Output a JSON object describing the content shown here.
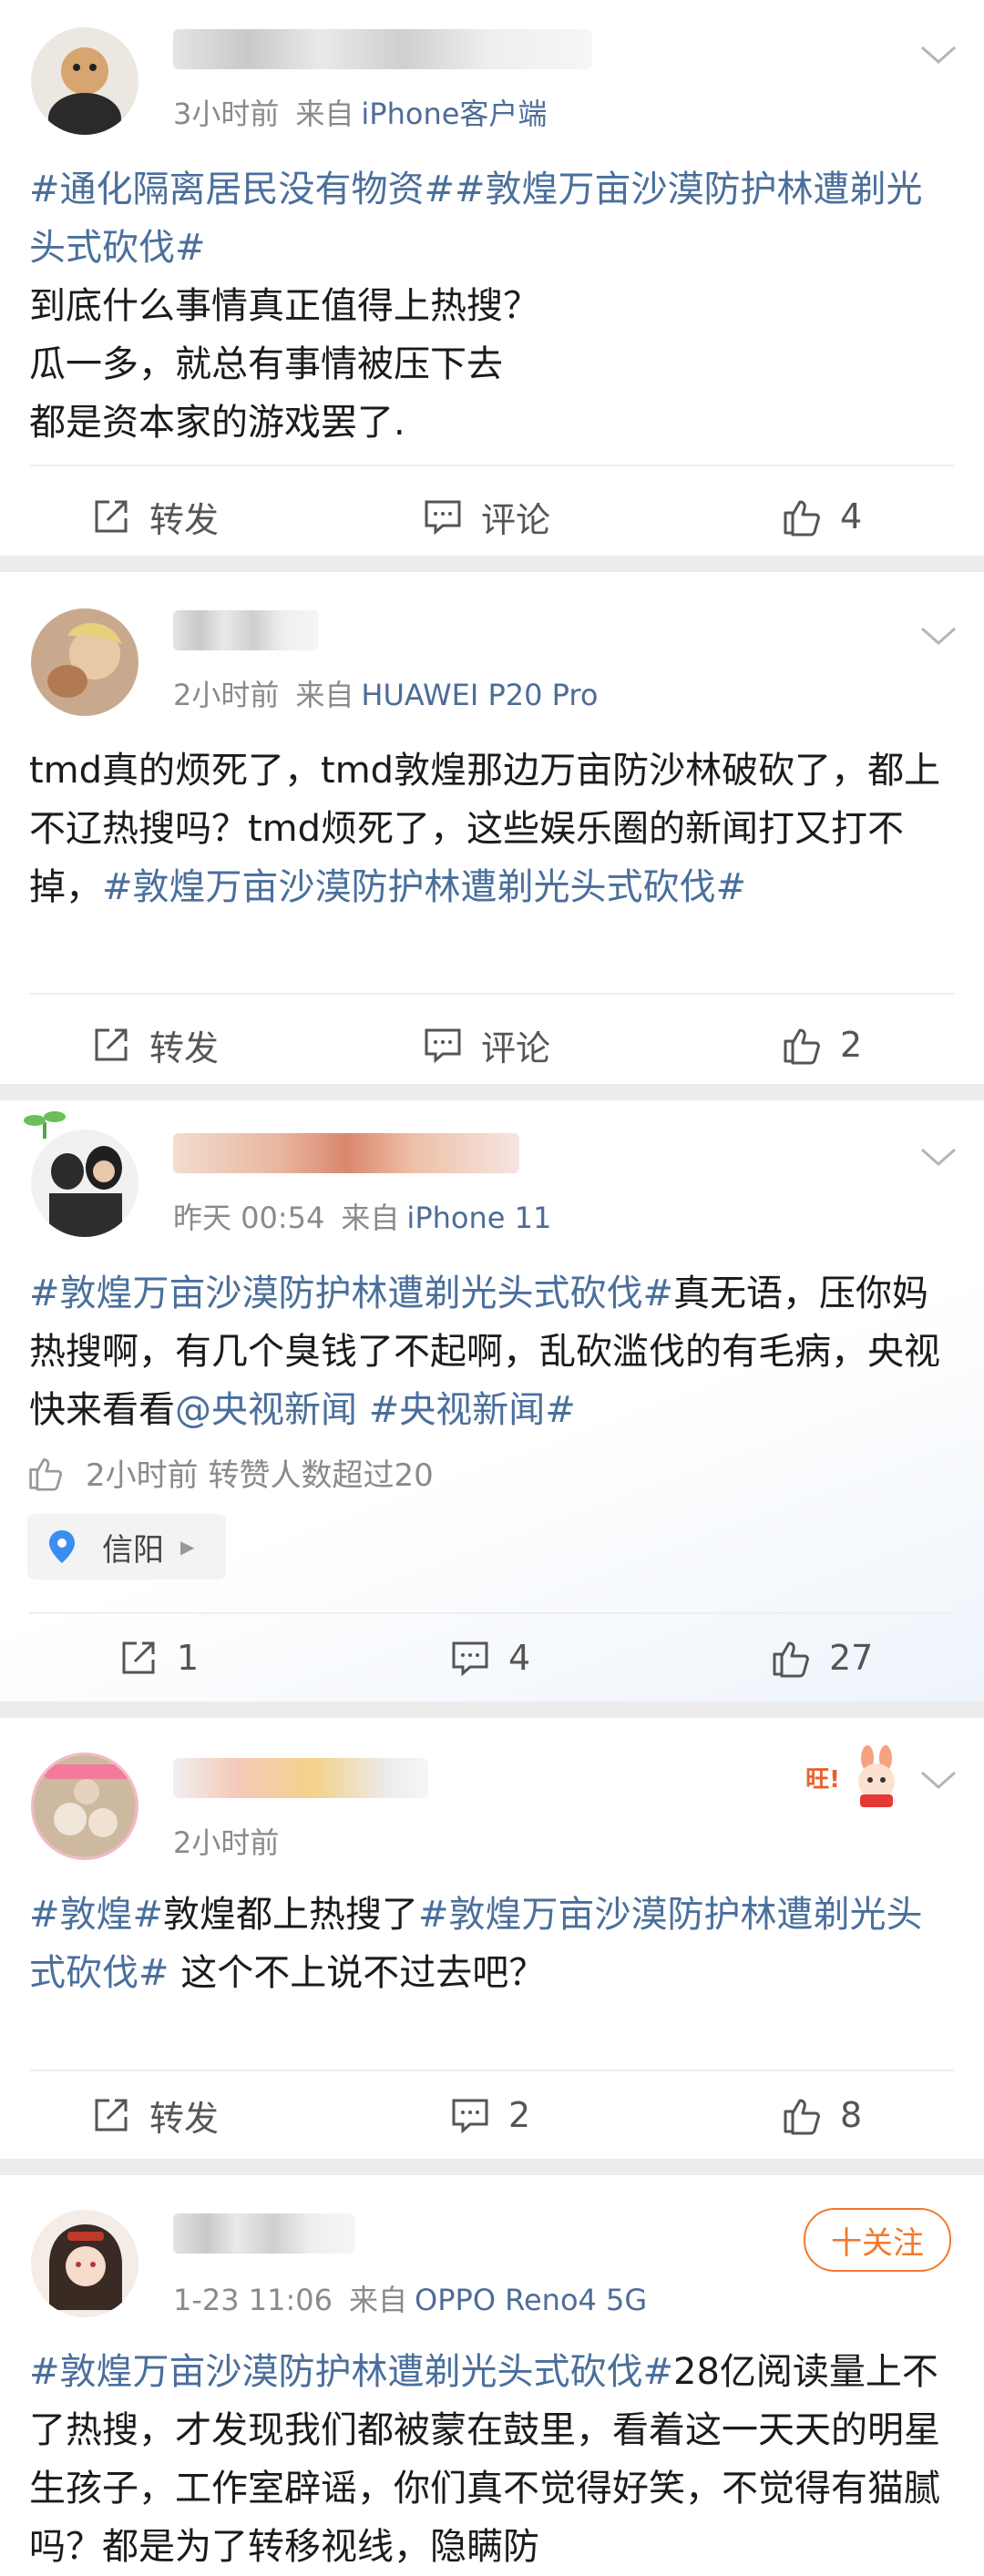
{
  "posts": [
    {
      "meta": "3小时前",
      "source": "来自",
      "device": "iPhone客户端",
      "text": [
        {
          "t": "#通化隔离居民没有物资##敦煌万亩沙漠防护林遭剃光头式砍伐#",
          "tag": true
        },
        {
          "t": "\n到底什么事情真正值得上热搜？\n瓜一多，就总有事情被压下去\n都是资本家的游戏罢了.",
          "tag": false
        }
      ],
      "actions": {
        "repost": "转发",
        "comment": "评论",
        "likes": "4"
      }
    },
    {
      "meta": "2小时前",
      "source": "来自",
      "device": "HUAWEI P20 Pro",
      "text": [
        {
          "t": "tmd真的烦死了，tmd敦煌那边万亩防沙林破砍了，都上不辽热搜吗？tmd烦死了，这些娱乐圈的新闻打又打不掉，",
          "tag": false
        },
        {
          "t": "#敦煌万亩沙漠防护林遭剃光头式砍伐#",
          "tag": true
        }
      ],
      "actions": {
        "repost": "转发",
        "comment": "评论",
        "likes": "2"
      }
    },
    {
      "meta": "昨天 00:54",
      "source": "来自",
      "device": "iPhone 11",
      "text": [
        {
          "t": "#敦煌万亩沙漠防护林遭剃光头式砍伐#",
          "tag": true
        },
        {
          "t": "真无语，压你妈热搜啊，有几个臭钱了不起啊，乱砍滥伐的有毛病，央视快来看看",
          "tag": false
        },
        {
          "t": "@央视新闻 #央视新闻#",
          "tag": true
        }
      ],
      "like_info": "2小时前 转赞人数超过20",
      "location": "信阳",
      "actions": {
        "repost": "1",
        "comment": "4",
        "likes": "27"
      }
    },
    {
      "meta": "2小时前",
      "text": [
        {
          "t": "#敦煌#",
          "tag": true
        },
        {
          "t": "敦煌都上热搜了",
          "tag": false
        },
        {
          "t": "#敦煌万亩沙漠防护林遭剃光头式砍伐#",
          "tag": true
        },
        {
          "t": " 这个不上说不过去吧？",
          "tag": false
        }
      ],
      "sticker": "旺!",
      "actions": {
        "repost": "转发",
        "comment": "2",
        "likes": "8"
      }
    },
    {
      "meta": "1-23 11:06",
      "source": "来自",
      "device": "OPPO Reno4 5G",
      "follow": "十关注",
      "text": [
        {
          "t": "#敦煌万亩沙漠防护林遭剃光头式砍伐#",
          "tag": true
        },
        {
          "t": "28亿阅读量上不了热搜，才发现我们都被蒙在鼓里，看着这一天天的明星生孩子，工作室辟谣，你们真不觉得好笑，不觉得有猫腻吗？都是为了转移视线，隐瞒防",
          "tag": false
        }
      ]
    }
  ],
  "icons": {
    "repost": "repost-icon",
    "comment": "comment-icon",
    "like": "thumbs-up-icon",
    "chevron": "chevron-down-icon",
    "pin": "location-pin-icon"
  },
  "colors": {
    "link": "#4a6f9c",
    "device": "#4e6c98",
    "meta": "#8a8a8a",
    "follow": "#f07a2b",
    "separator": "#ececec"
  }
}
